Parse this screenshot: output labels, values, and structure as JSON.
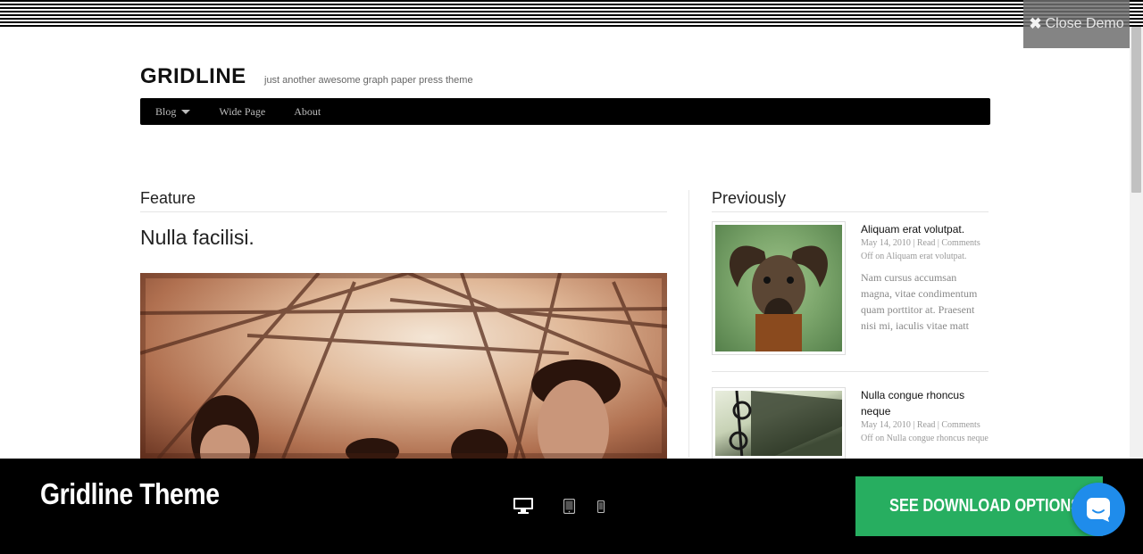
{
  "demo": {
    "close_label": "Close Demo"
  },
  "site": {
    "title": "GRIDLINE",
    "tagline": "just another awesome graph paper press theme"
  },
  "nav": {
    "items": [
      {
        "label": "Blog"
      },
      {
        "label": "Wide Page"
      },
      {
        "label": "About"
      }
    ]
  },
  "main": {
    "section_heading": "Feature",
    "post_title": "Nulla facilisi."
  },
  "sidebar": {
    "heading": "Previously",
    "posts": [
      {
        "title": "Aliquam erat volutpat.",
        "meta": "May 14, 2010 | Read | Comments Off on Aliquam erat volutpat.",
        "excerpt": "Nam cursus accumsan magna, vitae condimentum quam porttitor at. Praesent nisi mi, iaculis vitae matt"
      },
      {
        "title": "Nulla congue rhoncus neque",
        "meta": "May 14, 2010 | Read | Comments Off on Nulla congue rhoncus neque"
      }
    ]
  },
  "bottom_bar": {
    "theme_name": "Gridline Theme",
    "download_label": "SEE DOWNLOAD OPTIONS",
    "devices": [
      "desktop-icon",
      "tablet-icon",
      "phone-icon"
    ],
    "active_device": "desktop"
  },
  "colors": {
    "download_button": "#27ae60",
    "chat_bubble": "#1f8ceb",
    "nav_bar": "#000000"
  }
}
